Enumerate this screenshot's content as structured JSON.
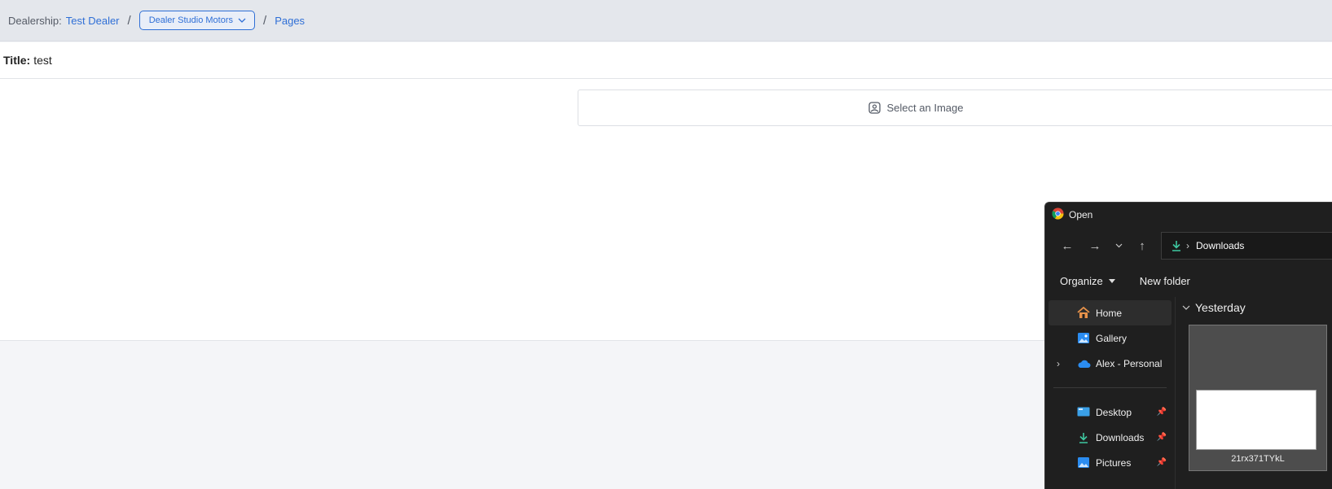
{
  "breadcrumb": {
    "dealership_label": "Dealership:",
    "dealer_link": "Test Dealer",
    "separator": "/",
    "dealer_select": "Dealer Studio Motors",
    "pages_link": "Pages"
  },
  "page": {
    "title_label": "Title:",
    "title_value": "test",
    "image_select_label": "Select an Image"
  },
  "dialog": {
    "title": "Open",
    "address": "Downloads",
    "toolbar": {
      "organize": "Organize",
      "new_folder": "New folder"
    },
    "sidebar": [
      {
        "label": "Home",
        "icon": "home-icon",
        "active": true
      },
      {
        "label": "Gallery",
        "icon": "gallery-icon"
      },
      {
        "label": "Alex - Personal",
        "icon": "cloud-icon",
        "expandable": true
      },
      {
        "label": "Desktop",
        "icon": "desktop-icon",
        "pinned": true
      },
      {
        "label": "Downloads",
        "icon": "download-icon",
        "pinned": true
      },
      {
        "label": "Pictures",
        "icon": "pictures-icon",
        "pinned": true
      }
    ],
    "group_label": "Yesterday",
    "file_name": "21rx371TYkL"
  },
  "colors": {
    "accent": "#2f6fd6",
    "dialog_bg": "#1f1f1f",
    "download_green": "#3ec7a0",
    "cloud_blue": "#2b8cf0"
  }
}
